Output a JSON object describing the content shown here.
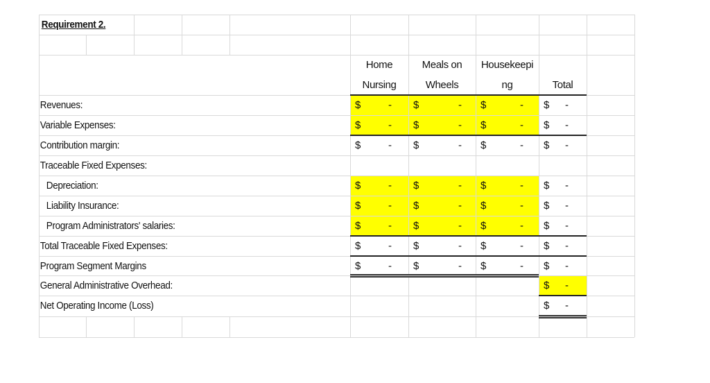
{
  "sheet": {
    "title": "Requirement 2.",
    "headers": {
      "home_nursing": [
        "Home",
        "Nursing"
      ],
      "meals_on_wheels": [
        "Meals on",
        "Wheels"
      ],
      "housekeeping": [
        "Housekeepi",
        "ng"
      ],
      "total": "Total"
    },
    "rows": [
      {
        "label": "Revenues:",
        "home": "-",
        "meals": "-",
        "house": "-",
        "total": "-",
        "input": true
      },
      {
        "label": "Variable Expenses:",
        "home": "-",
        "meals": "-",
        "house": "-",
        "total": "-",
        "input": true
      },
      {
        "label": "Contribution margin:",
        "home": "-",
        "meals": "-",
        "house": "-",
        "total": "-",
        "input": false
      },
      {
        "label": "Traceable Fixed Expenses:"
      },
      {
        "label": "Depreciation:",
        "home": "-",
        "meals": "-",
        "house": "-",
        "total": "-",
        "input": true
      },
      {
        "label": "Liability Insurance:",
        "home": "-",
        "meals": "-",
        "house": "-",
        "total": "-",
        "input": true
      },
      {
        "label": "Program Administrators' salaries:",
        "home": "-",
        "meals": "-",
        "house": "-",
        "total": "-",
        "input": true
      },
      {
        "label": "Total Traceable Fixed Expenses:",
        "home": "-",
        "meals": "-",
        "house": "-",
        "total": "-",
        "input": false
      },
      {
        "label": "Program Segment Margins",
        "home": "-",
        "meals": "-",
        "house": "-",
        "total": "-",
        "input": false
      },
      {
        "label": "General Administrative Overhead:",
        "total": "-",
        "input": true
      },
      {
        "label": "Net Operating Income (Loss)",
        "total": "-",
        "input": false
      }
    ],
    "currency_symbol": "$",
    "highlight_color": "#ffff00"
  }
}
